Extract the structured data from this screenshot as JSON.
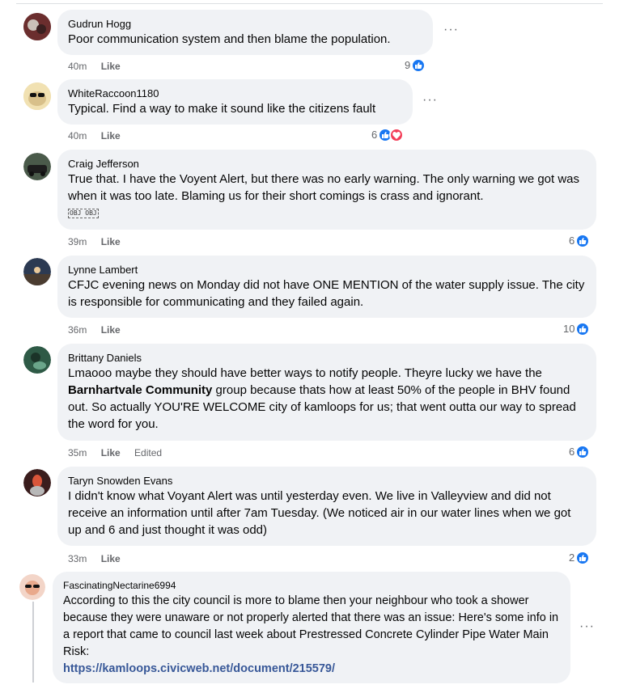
{
  "comments": [
    {
      "author": "Gudrun Hogg",
      "text": "Poor communication system and then blame the population.",
      "time": "40m",
      "like_label": "Like",
      "reaction_count": "9",
      "avatar_color": "#7a3b3b"
    },
    {
      "author": "WhiteRaccoon1180",
      "text": "Typical. Find a way to make it sound like the citizens fault",
      "time": "40m",
      "like_label": "Like",
      "reaction_count": "6",
      "avatar_color": "#e8d49a"
    },
    {
      "author": "Craig Jefferson",
      "text": "True that. I have the Voyent Alert, but there was no early warning. The only warning we got was when it was too late. Blaming us for their short comings is crass and ignorant.",
      "objtags": "OBJ OBJ",
      "time": "39m",
      "like_label": "Like",
      "reaction_count": "6",
      "avatar_color": "#3d4a3a"
    },
    {
      "author": "Lynne Lambert",
      "text": "CFJC evening news on Monday did not have ONE MENTION of the water supply issue. The city is responsible for communicating and they failed again.",
      "time": "36m",
      "like_label": "Like",
      "reaction_count": "10",
      "avatar_color": "#2e3b4e"
    },
    {
      "author": "Brittany Daniels",
      "text_before": "Lmaooo maybe they should have better ways to notify people. Theyre lucky we have the ",
      "text_bold": "Barnhartvale Community",
      "text_after": " group because thats how at least 50% of the people in BHV found out. So actually YOU'RE WELCOME city of kamloops for us; that went outta our way to spread the word for you.",
      "time": "35m",
      "like_label": "Like",
      "edited_label": "Edited",
      "reaction_count": "6",
      "avatar_color": "#2f5a44"
    },
    {
      "author": "Taryn Snowden Evans",
      "text": "I didn't know what Voyant Alert was until yesterday even. We live in Valleyview and did not receive an information until after 7am Tuesday. (We noticed air in our water lines when we got up and 6 and just thought it was odd)",
      "time": "33m",
      "like_label": "Like",
      "reaction_count": "2",
      "avatar_color": "#8a2a2a"
    },
    {
      "author": "FascinatingNectarine6994",
      "text": "According to this the city council is more to blame then your neighbour who took a shower because they were unaware or not properly alerted that there was an issue: Here's some info in a report that came to council last week about Prestressed Concrete Cylinder Pipe Water Main Risk:",
      "link": "https://kamloops.civicweb.net/document/215579/",
      "avatar_color": "#e9b9a8"
    }
  ],
  "more_label": "···",
  "icons": {
    "like": "thumbs-up-icon",
    "love": "heart-icon",
    "more": "more-dots-icon"
  },
  "colors": {
    "like_blue": "#1877f2",
    "love_red": "#f33e58",
    "bubble": "#f0f2f5",
    "meta": "#65676b"
  }
}
